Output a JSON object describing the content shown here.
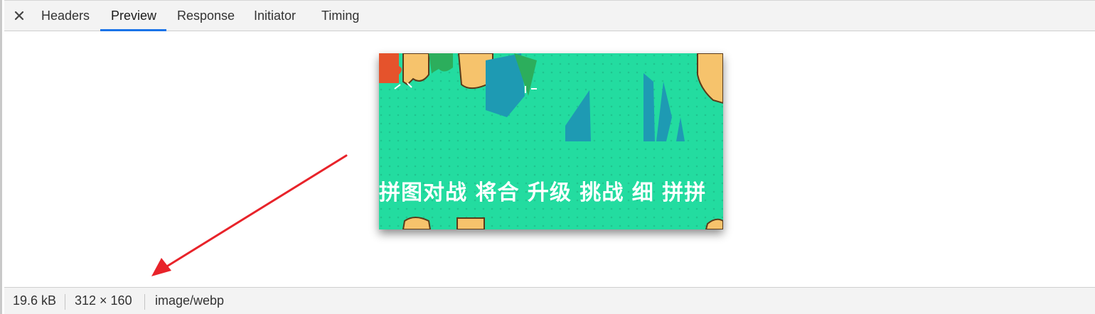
{
  "tabs": {
    "close_icon": "close-icon",
    "items": [
      {
        "label": "Headers"
      },
      {
        "label": "Preview"
      },
      {
        "label": "Response"
      },
      {
        "label": "Initiator"
      },
      {
        "label": "Timing"
      }
    ],
    "active": "Preview",
    "accent_color": "#1a73e8"
  },
  "preview": {
    "image_glyphs": "拼图对战  将合  升级  挑战  细  拼拼",
    "image_background": "#23dca0"
  },
  "status": {
    "size": "19.6 kB",
    "dimensions": "312 × 160",
    "mime_type": "image/webp"
  },
  "annotation": {
    "arrow_color": "#e8232a"
  }
}
